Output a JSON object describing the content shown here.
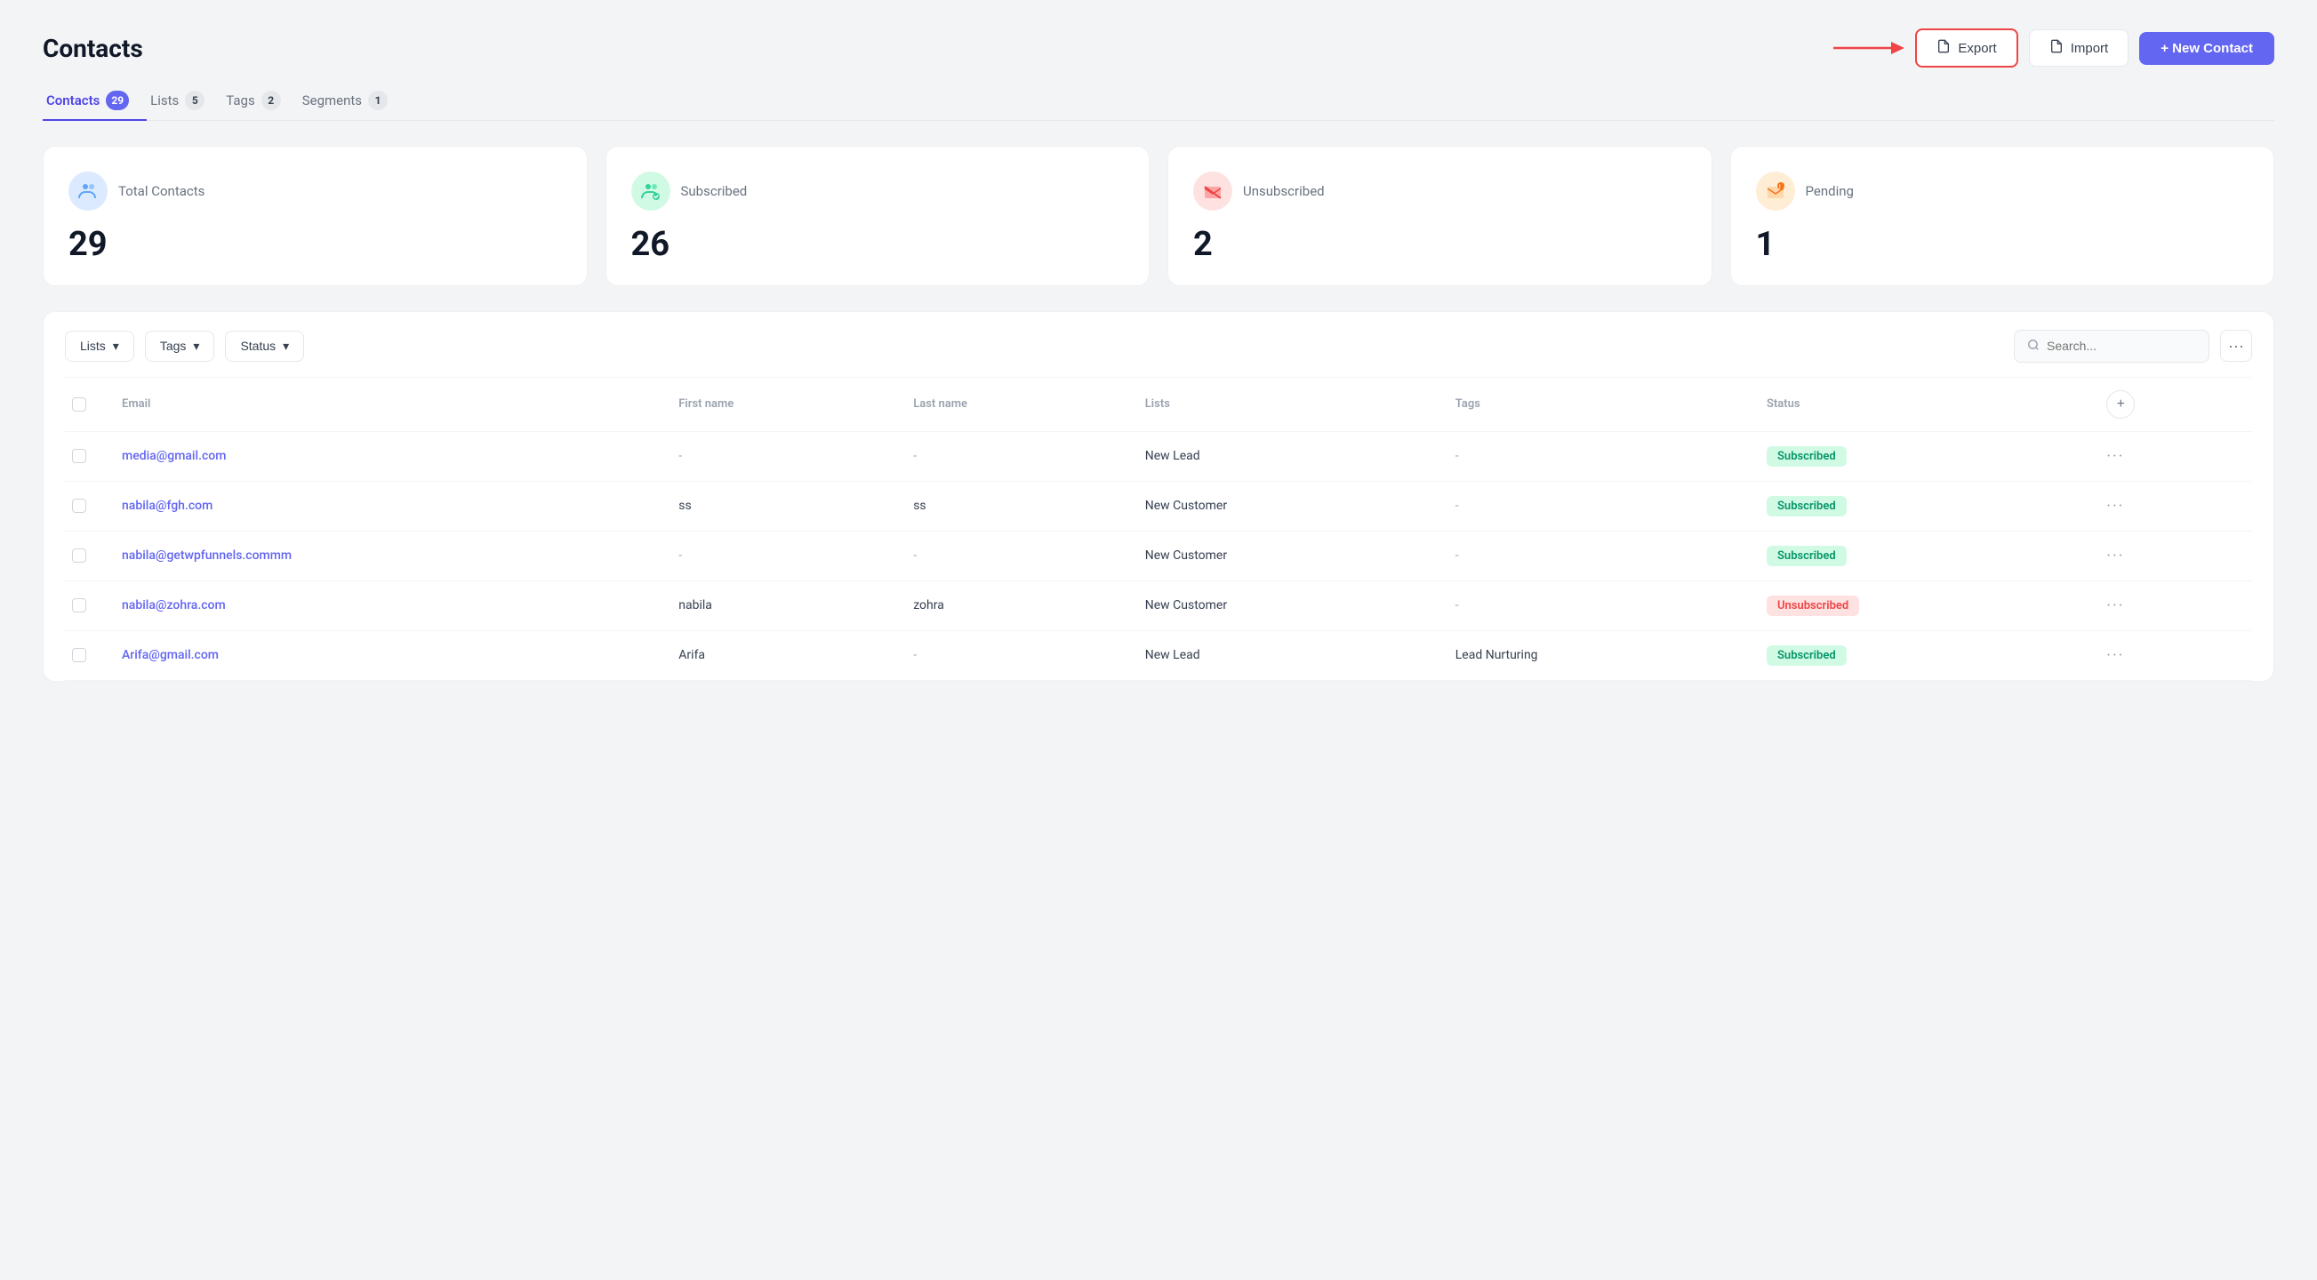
{
  "page": {
    "title": "Contacts"
  },
  "tabs": [
    {
      "id": "contacts",
      "label": "Contacts",
      "badge": "29",
      "badge_style": "purple",
      "active": true
    },
    {
      "id": "lists",
      "label": "Lists",
      "badge": "5",
      "badge_style": "gray",
      "active": false
    },
    {
      "id": "tags",
      "label": "Tags",
      "badge": "2",
      "badge_style": "gray",
      "active": false
    },
    {
      "id": "segments",
      "label": "Segments",
      "badge": "1",
      "badge_style": "gray",
      "active": false
    }
  ],
  "header": {
    "export_label": "Export",
    "import_label": "Import",
    "new_contact_label": "+ New Contact"
  },
  "stats": [
    {
      "id": "total",
      "icon": "👥",
      "icon_style": "blue",
      "label": "Total Contacts",
      "value": "29"
    },
    {
      "id": "subscribed",
      "icon": "👥",
      "icon_style": "green",
      "label": "Subscribed",
      "value": "26"
    },
    {
      "id": "unsubscribed",
      "icon": "✉️",
      "icon_style": "red",
      "label": "Unsubscribed",
      "value": "2"
    },
    {
      "id": "pending",
      "icon": "⏰",
      "icon_style": "orange",
      "label": "Pending",
      "value": "1"
    }
  ],
  "filters": {
    "lists_label": "Lists",
    "tags_label": "Tags",
    "status_label": "Status",
    "search_placeholder": "Search..."
  },
  "table": {
    "columns": [
      "Email",
      "First name",
      "Last name",
      "Lists",
      "Tags",
      "Status"
    ],
    "rows": [
      {
        "email": "media@gmail.com",
        "first_name": "-",
        "last_name": "-",
        "lists": "New Lead",
        "tags": "-",
        "status": "Subscribed",
        "status_type": "subscribed"
      },
      {
        "email": "nabila@fgh.com",
        "first_name": "ss",
        "last_name": "ss",
        "lists": "New Customer",
        "tags": "-",
        "status": "Subscribed",
        "status_type": "subscribed"
      },
      {
        "email": "nabila@getwpfunnels.commm",
        "first_name": "-",
        "last_name": "-",
        "lists": "New Customer",
        "tags": "-",
        "status": "Subscribed",
        "status_type": "subscribed"
      },
      {
        "email": "nabila@zohra.com",
        "first_name": "nabila",
        "last_name": "zohra",
        "lists": "New Customer",
        "tags": "-",
        "status": "Unsubscribed",
        "status_type": "unsubscribed"
      },
      {
        "email": "Arifa@gmail.com",
        "first_name": "Arifa",
        "last_name": "-",
        "lists": "New Lead",
        "tags": "Lead Nurturing",
        "status": "Subscribed",
        "status_type": "subscribed"
      }
    ]
  },
  "icons": {
    "export": "📄",
    "import": "📥",
    "search": "🔍",
    "chevron_down": "▾",
    "more": "···",
    "plus": "+"
  },
  "colors": {
    "accent": "#6366f1",
    "export_border": "#ef4444",
    "subscribed_bg": "#d1fae5",
    "subscribed_text": "#059669",
    "unsubscribed_bg": "#fee2e2",
    "unsubscribed_text": "#ef4444"
  }
}
